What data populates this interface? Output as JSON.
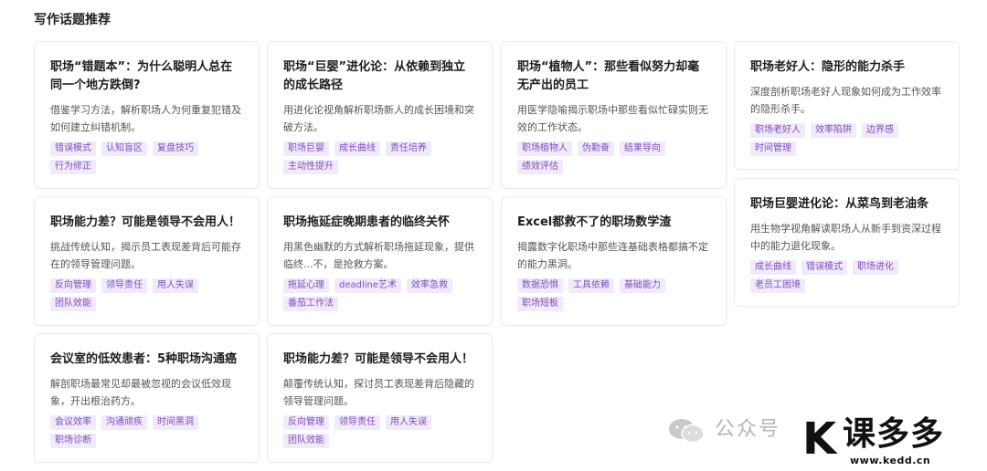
{
  "section": {
    "title": "写作话题推荐"
  },
  "cards": [
    {
      "title": "职场“错题本”：为什么聪明人总在同一个地方跌倒?",
      "desc": "借鉴学习方法，解析职场人为何重复犯错及如何建立纠错机制。",
      "tags": [
        "错误模式",
        "认知盲区",
        "复盘技巧",
        "行为修正"
      ]
    },
    {
      "title": "职场“巨婴”进化论：从依赖到独立的成长路径",
      "desc": "用进化论视角解析职场新人的成长困境和突破方法。",
      "tags": [
        "职场巨婴",
        "成长曲线",
        "责任培养",
        "主动性提升"
      ]
    },
    {
      "title": "职场“植物人”：那些看似努力却毫无产出的员工",
      "desc": "用医学隐喻揭示职场中那些看似忙碌实则无效的工作状态。",
      "tags": [
        "职场植物人",
        "伪勤奋",
        "结果导向",
        "绩效评估"
      ]
    },
    {
      "title": "职场老好人：隐形的能力杀手",
      "desc": "深度剖析职场老好人现象如何成为工作效率的隐形杀手。",
      "tags": [
        "职场老好人",
        "效率陷阱",
        "边界感",
        "时间管理"
      ]
    },
    {
      "title": "职场能力差？可能是领导不会用人！",
      "desc": "挑战传统认知，揭示员工表现差背后可能存在的领导管理问题。",
      "tags": [
        "反向管理",
        "领导责任",
        "用人失误",
        "团队效能"
      ]
    },
    {
      "title": "职场拖延症晚期患者的临终关怀",
      "desc": "用黑色幽默的方式解析职场拖延现象，提供临终...不，是抢救方案。",
      "tags": [
        "拖延心理",
        "deadline艺术",
        "效率急救",
        "番茄工作法"
      ]
    },
    {
      "title": "Excel都救不了的职场数学渣",
      "desc": "揭露数字化职场中那些连基础表格都搞不定的能力黑洞。",
      "tags": [
        "数据恐惧",
        "工具依赖",
        "基础能力",
        "职场短板"
      ]
    },
    {
      "title": "职场巨婴进化论：从菜鸟到老油条",
      "desc": "用生物学视角解读职场人从新手到资深过程中的能力退化现象。",
      "tags": [
        "成长曲线",
        "错误模式",
        "职场进化",
        "老员工困境"
      ]
    },
    {
      "title": "会议室的低效患者：5种职场沟通癌",
      "desc": "解剖职场最常见却最被忽视的会议低效现象，开出根治药方。",
      "tags": [
        "会议效率",
        "沟通顽疾",
        "时间黑洞",
        "职场诊断"
      ]
    },
    {
      "title": "职场能力差？可能是领导不会用人！",
      "desc": "颠覆传统认知，探讨员工表现差背后隐藏的领导管理问题。",
      "tags": [
        "反向管理",
        "领导责任",
        "用人失误",
        "团队效能"
      ]
    }
  ],
  "watermark": {
    "platform_text": "公众号",
    "logo_mark": "K",
    "logo_text": "课多多",
    "url": "www.kedd.cn"
  }
}
